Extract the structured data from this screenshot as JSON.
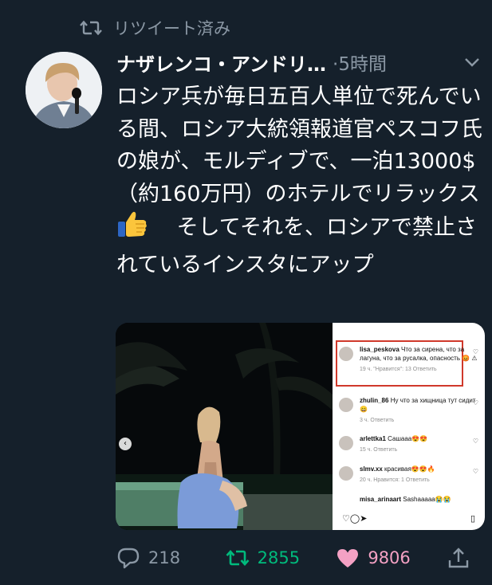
{
  "retweet_banner": {
    "label": "リツイート済み"
  },
  "tweet": {
    "author": "ナザレンコ・アンドリ…",
    "meta": "·5時間",
    "text_before": "ロシア兵が毎日五百人単位で死んでいる間、ロシア大統領報道官ペスコフ氏の娘が、モルディブで、一泊13000$ （約160万円）のホテルでリラックス",
    "emoji": "👍",
    "text_after": "　 そしてそれを、ロシアで禁止されているインスタにアップ"
  },
  "media": {
    "comments": [
      {
        "user": "lisa_peskova",
        "text": "Что за сирена, что за лагуна, что за русалка, опасность 😡 ⚠",
        "time": "19 ч.",
        "likes": "\"Нравится\": 13",
        "reply": "Ответить"
      },
      {
        "user": "zhulin_86",
        "text": "Ну что за хищница тут сидит 😄",
        "time": "3 ч.",
        "likes": "",
        "reply": "Ответить"
      },
      {
        "user": "arlettka1",
        "text": "Сашааа😍😍",
        "time": "15 ч.",
        "likes": "",
        "reply": "Ответить"
      },
      {
        "user": "slmv.xx",
        "text": "красивая😍😍🔥",
        "time": "20 ч.",
        "likes": "Нравится: 1",
        "reply": "Ответить"
      },
      {
        "user": "misa_arinaart",
        "text": "Sashaaaaa😭😭",
        "time": "",
        "likes": "",
        "reply": ""
      }
    ],
    "icons": [
      "heart-outline-icon",
      "comment-outline-icon",
      "send-icon",
      "bookmark-icon"
    ]
  },
  "actions": {
    "replies": "218",
    "retweets": "2855",
    "likes": "9806"
  },
  "colors": {
    "background": "#15202b",
    "secondary_text": "#8b98a5",
    "retweet_green": "#00ba7c",
    "like_pink": "#f91880"
  }
}
